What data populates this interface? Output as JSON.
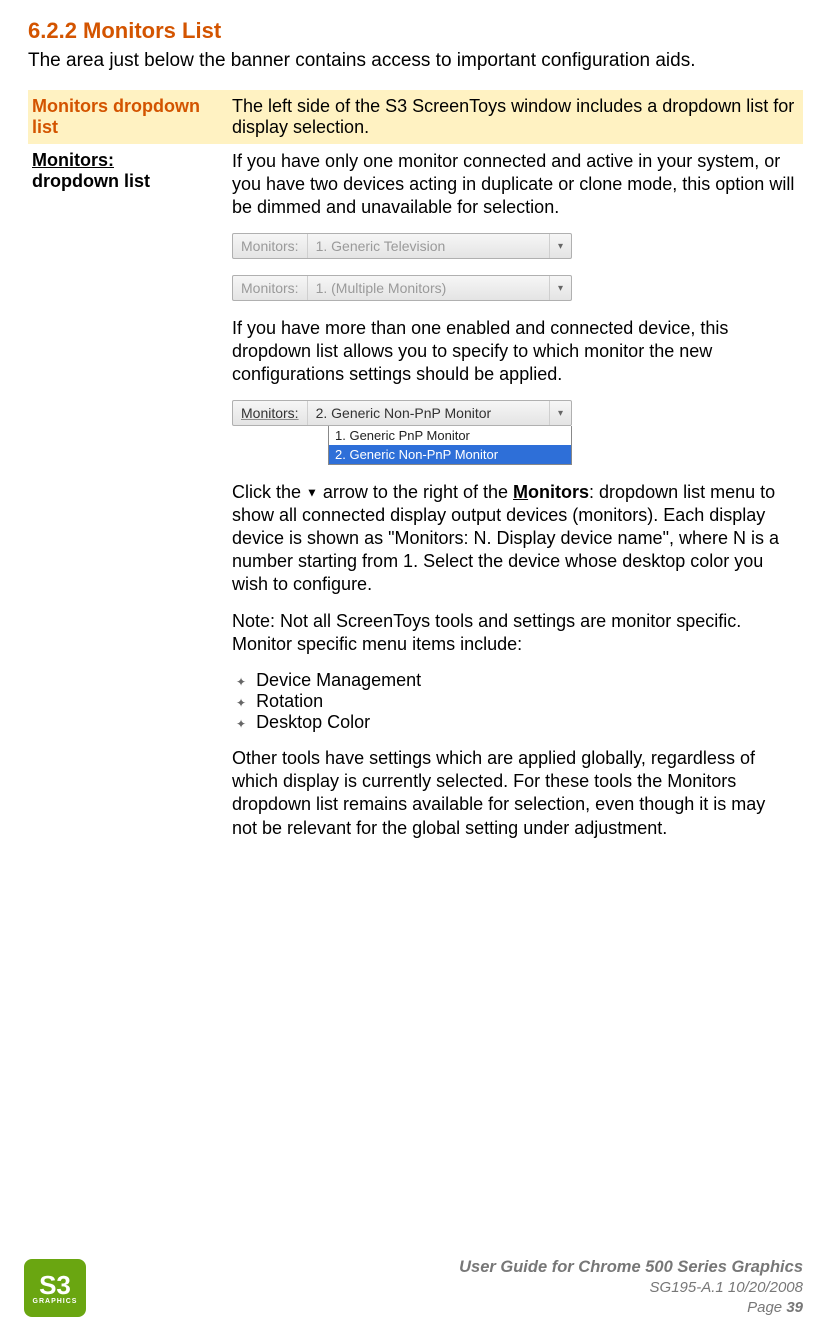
{
  "heading": "6.2.2 Monitors List",
  "intro": "The area just below the banner contains access to important configuration aids.",
  "rows": {
    "r1": {
      "label": "Monitors dropdown list",
      "text": "The left side of the S3 ScreenToys window includes a dropdown list for display selection."
    },
    "r2": {
      "label_line1": "Monitors:",
      "label_line2": "dropdown list",
      "p1": "If you have only one monitor connected and active in your system, or you have two devices acting in duplicate or clone mode, this option will be dimmed and unavailable for selection.",
      "dd1": {
        "label": "Monitors:",
        "value": "1. Generic Television"
      },
      "dd2": {
        "label": "Monitors:",
        "value": "1. (Multiple Monitors)"
      },
      "p2": "If you have more than one enabled and connected device, this dropdown list allows you to specify to which monitor the new configurations settings should be applied.",
      "dd3": {
        "label": "Monitors:",
        "value": "2. Generic Non-PnP Monitor",
        "options": [
          "1. Generic PnP Monitor",
          "2. Generic Non-PnP Monitor"
        ],
        "selected_index": 1
      },
      "p3a": "Click the ",
      "p3b": " arrow to the right of the ",
      "p3_monword": "M",
      "p3_rest": "onitors",
      "p3c": ": dropdown list menu to show all connected display output devices (monitors). Each display device is shown as \"Monitors: N. Display device name\", where N is a number starting from 1. Select the device whose desktop color you wish to configure.",
      "p4": "Note: Not all ScreenToys tools and settings are monitor specific. Monitor specific menu items include:",
      "bullets": [
        "Device Management",
        "Rotation",
        "Desktop Color"
      ],
      "p5": "Other tools have settings which are applied globally, regardless of which display is currently selected. For these tools the Monitors dropdown list remains available for selection, even though it is may not be relevant for the global setting under adjustment."
    }
  },
  "footer": {
    "title": "User Guide for Chrome 500 Series Graphics",
    "docref": "SG195-A.1   10/20/2008",
    "page_label": "Page ",
    "page_num": "39",
    "logo_text": "S3",
    "logo_sub": "GRAPHICS"
  }
}
